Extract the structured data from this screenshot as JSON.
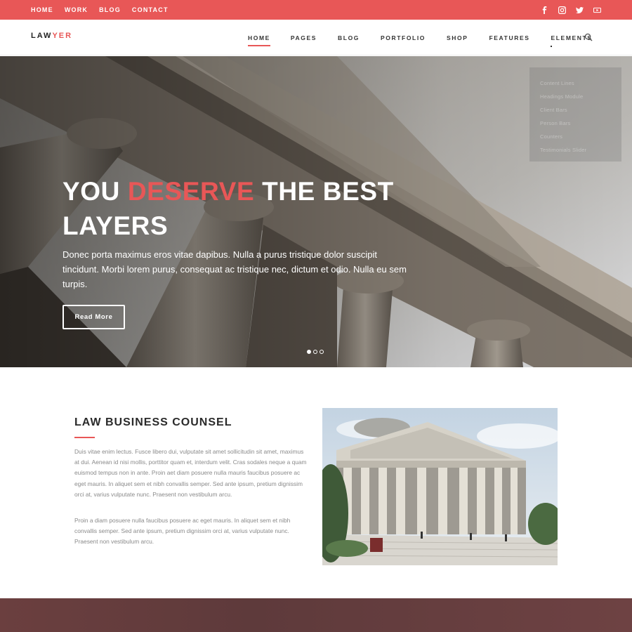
{
  "topbar": {
    "nav": [
      "HOME",
      "WORK",
      "BLOG",
      "CONTACT"
    ],
    "social_icons": [
      "facebook-icon",
      "instagram-icon",
      "twitter-icon",
      "youtube-icon"
    ],
    "color": "#e85757"
  },
  "header": {
    "logo_main": "LAW",
    "logo_accent": "YER",
    "nav": [
      "HOME",
      "PAGES",
      "BLOG",
      "PORTFOLIO",
      "SHOP",
      "FEATURES",
      "ELEMENTS"
    ],
    "active_nav": "HOME",
    "search_icon": "search-icon"
  },
  "dropdown": {
    "items": [
      "Content Lines",
      "Headings Module",
      "Client Bars",
      "Person Bars",
      "Counters",
      "Testimonials Slider"
    ]
  },
  "hero": {
    "title_part1": "YOU ",
    "title_accent": "DESERVE",
    "title_part2": " THE BEST LAYERS",
    "text": "Donec porta maximus eros vitae dapibus. Nulla a purus tristique dolor suscipit tincidunt. Morbi lorem purus, consequat ac tristique nec, dictum et odio. Nulla eu sem turpis.",
    "button": "Read More",
    "slides": 3,
    "active_slide": 1
  },
  "section": {
    "title": "LAW BUSINESS COUNSEL",
    "para1": "Duis vitae enim lectus. Fusce libero dui, vulputate sit amet sollicitudin sit amet, maximus at dui. Aenean id nisi mollis, porttitor quam et, interdum velit. Cras sodales neque a quam euismod tempus non in ante. Proin aet diam posuere nulla mauris faucibus posuere ac eget mauris. In aliquet sem et nibh convallis semper. Sed ante ipsum, pretium dignissim orci at, varius vulputate nunc. Praesent non vestibulum arcu.",
    "para2": "Proin a diam posuere nulla faucibus posuere ac eget mauris. In aliquet sem et nibh convallis semper. Sed ante ipsum, pretium dignissim orci at, varius vulputate nunc. Praesent non vestibulum arcu."
  },
  "colors": {
    "accent": "#e85757",
    "band": "#6b3f3f"
  }
}
